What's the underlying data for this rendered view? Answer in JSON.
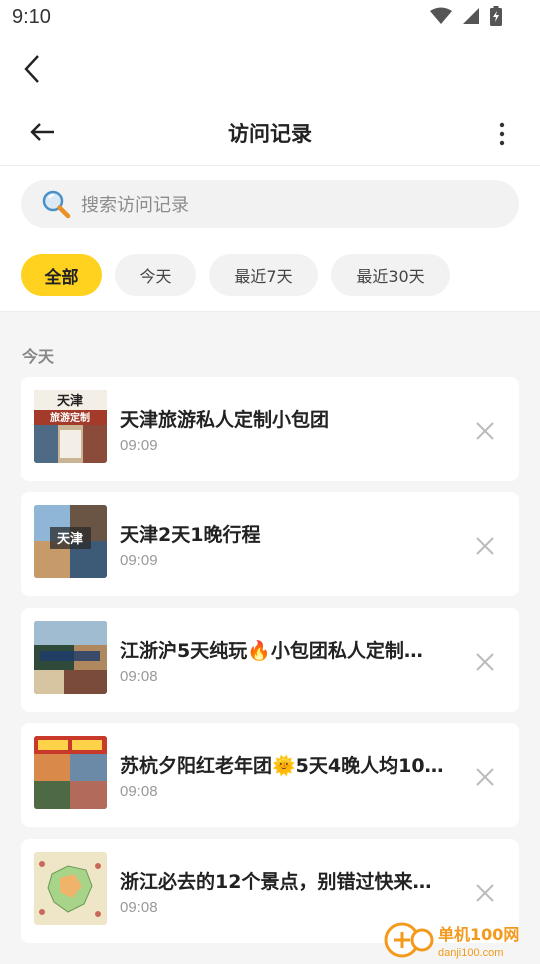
{
  "status_bar": {
    "time": "9:10"
  },
  "header": {
    "title": "访问记录"
  },
  "search": {
    "placeholder": "搜索访问记录"
  },
  "filters": [
    "全部",
    "今天",
    "最近7天",
    "最近30天"
  ],
  "section": {
    "label": "今天"
  },
  "items": [
    {
      "title": "天津旅游私人定制小包团",
      "time": "09:09",
      "thumb_text": [
        "天津",
        "旅游定制"
      ]
    },
    {
      "title": "天津2天1晚行程",
      "time": "09:09",
      "thumb_text": [
        "天津"
      ]
    },
    {
      "title": "江浙沪5天纯玩🔥小包团私人定制…",
      "time": "09:08",
      "thumb_text": []
    },
    {
      "title": "苏杭夕阳红老年团🌞5天4晚人均10…",
      "time": "09:08",
      "thumb_text": []
    },
    {
      "title": "浙江必去的12个景点，别错过快来…",
      "time": "09:08",
      "thumb_text": []
    }
  ],
  "watermark": {
    "brand": "单机100网",
    "url": "danji100.com"
  },
  "colors": {
    "accent": "#ffd21f",
    "background": "#f5f5f5"
  }
}
